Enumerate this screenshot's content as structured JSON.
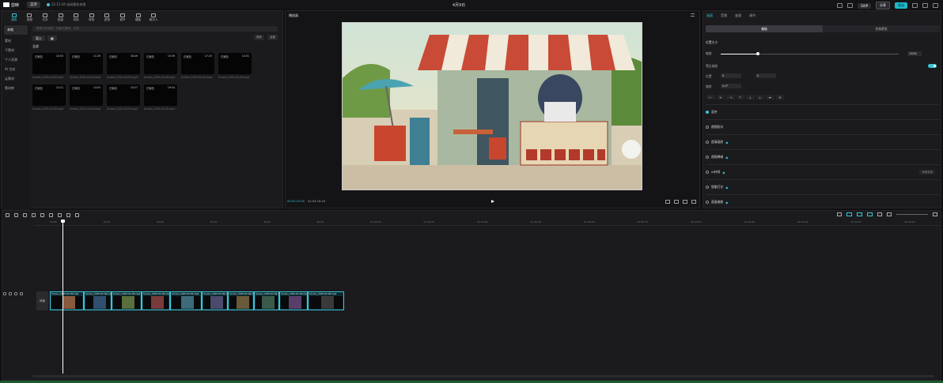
{
  "app": {
    "name": "剪映",
    "menu_label": "菜单",
    "autosave": "11:11:34 自动保存本地",
    "project_title": "4月9日"
  },
  "header": {
    "pro_label": "SVIP",
    "share_label": "分享",
    "export_label": "导出"
  },
  "media_tools": [
    "媒体",
    "音频",
    "文本",
    "贴纸",
    "特效",
    "转场",
    "滤镜",
    "调节",
    "模板",
    "数字人"
  ],
  "media_sidebar": [
    "本地",
    "素材",
    "子素材",
    "个人资源",
    "AI 生成",
    "云素材",
    "素材库"
  ],
  "media": {
    "search_placeholder": "搜索文件名称、场景关键词、台词",
    "import_label": "导入",
    "sort_label": "排序",
    "filter_label": "全部",
    "all_label": "全部",
    "clips": [
      {
        "added": "已添加",
        "duration": "10:53",
        "name": "Screen_2025-04-09.mp4"
      },
      {
        "added": "已添加",
        "duration": "11:29",
        "name": "Screen_2025-04-09.mp4"
      },
      {
        "added": "已添加",
        "duration": "16:49",
        "name": "Screen_2025-04-09.mp4"
      },
      {
        "added": "已添加",
        "duration": "15:39",
        "name": "Screen_2025-04-09.mp4"
      },
      {
        "added": "已添加",
        "duration": "17:23",
        "name": "Screen_2025-04-09.mp4"
      },
      {
        "added": "已添加",
        "duration": "14:51",
        "name": "Screen_2025-04-09.mp4"
      },
      {
        "added": "已添加",
        "duration": "14:11",
        "name": "Screen_2025-04-09.mp4"
      },
      {
        "added": "已添加",
        "duration": "14:03",
        "name": "Screen_2025-04-09.mp4"
      },
      {
        "added": "已添加",
        "duration": "10:27",
        "name": "Screen_2025-04-09.mp4"
      },
      {
        "added": "已添加",
        "duration": "19:54",
        "name": "Screen_2025-04-09.mp4"
      }
    ]
  },
  "player": {
    "title": "播放器",
    "current_time": "00:07:47:00",
    "total_time": "02:43:16:16"
  },
  "inspector": {
    "tabs": [
      "画面",
      "音频",
      "变速",
      "调节"
    ],
    "segments": [
      "基础",
      "抠像蒙版"
    ],
    "position_size": "位置大小",
    "scale_label": "缩放",
    "scale_value": "100%",
    "uniform_scale": "等比缩放",
    "position_label": "位置",
    "pos_x": "0",
    "pos_y": "0",
    "rotate_label": "旋转",
    "rotate_value": "0.0°",
    "sections": [
      "混合",
      "视频防抖",
      "超清画质",
      "视频降噪",
      "AI补帧",
      "智能打光",
      "画面缩放"
    ],
    "frame_interp_option": "帧率选择"
  },
  "timeline": {
    "ruler": [
      "00:00",
      "10:00",
      "20:00",
      "30:00",
      "40:00",
      "50:00",
      "01:00:00",
      "01:10:00",
      "01:20:00",
      "01:30:00",
      "01:40:00",
      "01:50:00",
      "02:00:00",
      "02:10:00",
      "02:20:00",
      "02:30:00",
      "02:40:00"
    ],
    "cover_label": "封面",
    "clip_label": "Screen_2025-04-09.mp4",
    "clip_count": 11
  }
}
